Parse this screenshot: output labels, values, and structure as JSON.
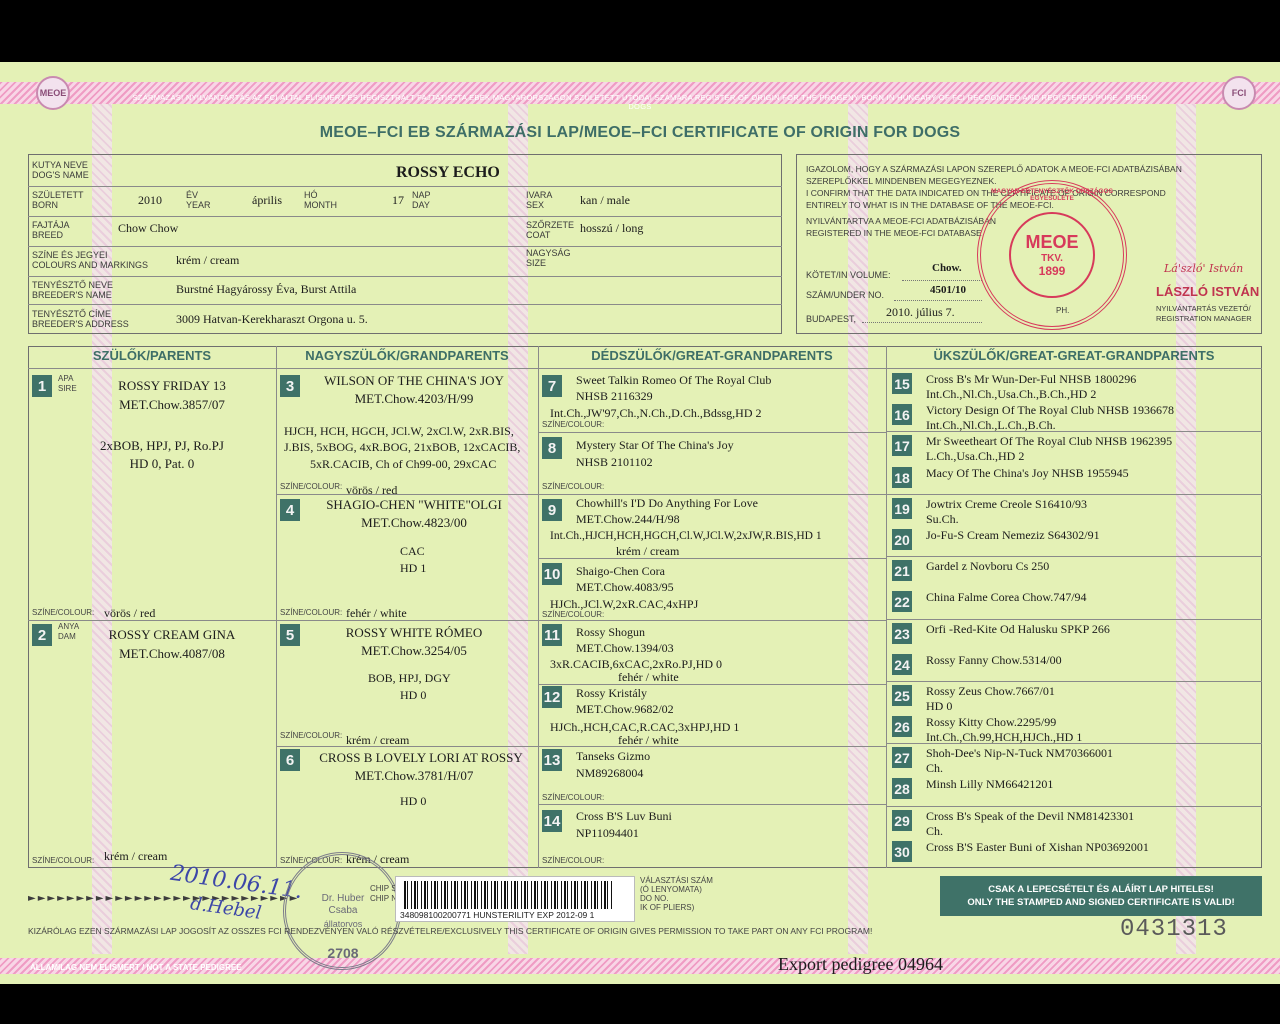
{
  "header": {
    "band_text": "SZÁRMAZÁSI NYILVÁNTARTÁS AZ FCI ÁLTAL ELISMERT ÉS REGISZTRÁLT FAJTATISZTA EBEK MAGYARORSZÁGON SZÜLETETT UTÓDAI SZÁMÁRA REGISTER OF ORIGIN FOR THE PROGENY BORN IN HUNGARY OF FCI RECOGNIZED AND REGISTERED PURE - BRED DOGS",
    "title": "MEOE–FCI EB SZÁRMAZÁSI LAP/MEOE–FCI CERTIFICATE OF ORIGIN FOR DOGS",
    "seal_left": "MEOE",
    "seal_right": "FCI"
  },
  "dog": {
    "name_label_hu": "KUTYA NEVE",
    "name_label_en": "DOG'S NAME",
    "name": "ROSSY ECHO",
    "born_label_hu": "SZÜLETETT",
    "born_label_en": "BORN",
    "year": "2010",
    "year_label_hu": "ÉV",
    "year_label_en": "YEAR",
    "month": "április",
    "month_label_hu": "HÓ",
    "month_label_en": "MONTH",
    "day": "17",
    "day_label_hu": "NAP",
    "day_label_en": "DAY",
    "sex_label_hu": "IVARA",
    "sex_label_en": "SEX",
    "sex": "kan / male",
    "breed_label_hu": "FAJTÁJA",
    "breed_label_en": "BREED",
    "breed": "Chow Chow",
    "coat_label_hu": "SZŐRZETE",
    "coat_label_en": "COAT",
    "coat": "hosszú / long",
    "colour_label_hu": "SZÍNE ÉS JEGYEI",
    "colour_label_en": "COLOURS AND MARKINGS",
    "colour": "krém / cream",
    "size_label_hu": "NAGYSÁG",
    "size_label_en": "SIZE",
    "breeder_label_hu": "TENYÉSZTŐ NEVE",
    "breeder_label_en": "BREEDER'S NAME",
    "breeder": "Burstné Hagyárossy Éva, Burst Attila",
    "address_label_hu": "TENYÉSZTŐ CÍME",
    "address_label_en": "BREEDER'S ADDRESS",
    "address": "3009 Hatvan-Kerekharaszt Orgona u. 5."
  },
  "registration": {
    "statement": [
      "IGAZOLOM, HOGY A SZÁRMAZÁSI LAPON SZEREPLŐ ADATOK A MEOE-FCI ADATBÁZISÁBAN",
      "SZEREPLŐKKEL MINDENBEN MEGEGYEZNEK.",
      "I CONFIRM THAT THE DATA INDICATED ON THE CERTIFICATE OF ORIGIN CORRESPOND",
      "ENTIRELY TO WHAT IS IN THE DATABASE OF THE MEOE-FCI.",
      "NYILVÁNTARTVA A MEOE-FCI ADATBÁZISÁBAN",
      "REGISTERED IN THE MEOE-FCI DATABASE"
    ],
    "volume_label": "KÖTET/IN VOLUME:",
    "volume": "Chow.",
    "number_label": "SZÁM/UNDER No.",
    "number": "4501/10",
    "city": "BUDAPEST,",
    "date": "2010. július 7.",
    "ph": "PH.",
    "signature": "Lá'szló' István",
    "signer_name": "LÁSZLÓ ISTVÁN",
    "signer_title_hu": "NYILVÁNTARTÁS VEZETŐ/",
    "signer_title_en": "REGISTRATION MANAGER"
  },
  "stamp_red": {
    "center": "MEOE",
    "tkv": "TKV.",
    "year": "1899",
    "ring": "MAGYAR EBTENYÉSZTŐK ORSZÁGOS EGYESÜLETE"
  },
  "columns": {
    "parents": "SZÜLŐK/PARENTS",
    "grandparents": "NAGYSZÜLŐK/GRANDPARENTS",
    "great": "DÉDSZÜLŐK/GREAT-GRANDPARENTS",
    "greatgreat": "ÜKSZÜLŐK/GREAT-GREAT-GRANDPARENTS"
  },
  "labels": {
    "colour": "SZÍNE/COLOUR:",
    "sire_hu": "APA",
    "sire_en": "SIRE",
    "dam_hu": "ANYA",
    "dam_en": "DAM"
  },
  "parents": [
    {
      "num": "1",
      "name": "ROSSY FRIDAY 13",
      "reg": "MET.Chow.3857/07",
      "titles": "2xBOB, HPJ, PJ, Ro.PJ",
      "hd": "HD 0, Pat. 0",
      "colour": "vörös / red"
    },
    {
      "num": "2",
      "name": "ROSSY CREAM GINA",
      "reg": "MET.Chow.4087/08",
      "colour": "krém / cream"
    }
  ],
  "grandparents": [
    {
      "num": "3",
      "name": "WILSON OF THE CHINA'S JOY",
      "reg": "MET.Chow.4203/H/99",
      "titles": [
        "HJCH, HCH, HGCH, JCl.W, 2xCl.W, 2xR.BIS,",
        "J.BIS, 5xBOG, 4xR.BOG, 21xBOB, 12xCACIB,",
        "5xR.CACIB, Ch of Ch99-00, 29xCAC"
      ],
      "colour": "vörös / red"
    },
    {
      "num": "4",
      "name": "SHAGIO-CHEN \"WHITE\"OLGI",
      "reg": "MET.Chow.4823/00",
      "titles": [
        "CAC"
      ],
      "hd": "HD 1",
      "colour": "fehér / white"
    },
    {
      "num": "5",
      "name": "ROSSY WHITE RÓMEO",
      "reg": "MET.Chow.3254/05",
      "titles": [
        "BOB, HPJ, DGY"
      ],
      "hd": "HD 0",
      "colour": "krém / cream"
    },
    {
      "num": "6",
      "name": "CROSS B LOVELY LORI AT ROSSY",
      "reg": "MET.Chow.3781/H/07",
      "hd": "HD 0",
      "colour": "krém / cream"
    }
  ],
  "great": [
    {
      "num": "7",
      "name": "Sweet Talkin Romeo Of The Royal Club",
      "reg": "NHSB 2116329",
      "titles": "Int.Ch.,JW'97,Ch.,N.Ch.,D.Ch.,Bdssg,HD 2"
    },
    {
      "num": "8",
      "name": "Mystery Star Of The China's Joy",
      "reg": "NHSB 2101102"
    },
    {
      "num": "9",
      "name": "Chowhill's I'D Do Anything For Love",
      "reg": "MET.Chow.244/H/98",
      "titles": "Int.Ch.,HJCH,HCH,HGCH,Cl.W,JCl.W,2xJW,R.BIS,HD 1",
      "colour": "krém / cream"
    },
    {
      "num": "10",
      "name": "Shaigo-Chen Cora",
      "reg": "MET.Chow.4083/95",
      "titles": "HJCh.,JCl.W,2xR.CAC,4xHPJ"
    },
    {
      "num": "11",
      "name": "Rossy Shogun",
      "reg": "MET.Chow.1394/03",
      "titles": "3xR.CACIB,6xCAC,2xRo.PJ,HD 0",
      "colour": "fehér / white"
    },
    {
      "num": "12",
      "name": "Rossy Kristály",
      "reg": "MET.Chow.9682/02",
      "titles": "HJCh.,HCH,CAC,R.CAC,3xHPJ,HD 1",
      "colour": "fehér / white"
    },
    {
      "num": "13",
      "name": "Tanseks Gizmo",
      "reg": "NM89268004"
    },
    {
      "num": "14",
      "name": "Cross B'S Luv Buni",
      "reg": "NP11094401"
    }
  ],
  "greatgreat": [
    {
      "num": "15",
      "line1": "Cross B's Mr Wun-Der-Ful NHSB 1800296",
      "line2": "Int.Ch.,Nl.Ch.,Usa.Ch.,B.Ch.,HD 2"
    },
    {
      "num": "16",
      "line1": "Victory Design Of The Royal Club NHSB 1936678",
      "line2": "Int.Ch.,Nl.Ch.,L.Ch.,B.Ch."
    },
    {
      "num": "17",
      "line1": "Mr Sweetheart Of The Royal Club NHSB 1962395",
      "line2": "L.Ch.,Usa.Ch.,HD 2"
    },
    {
      "num": "18",
      "line1": "Macy Of The China's Joy NHSB 1955945"
    },
    {
      "num": "19",
      "line1": "Jowtrix Creme Creole S16410/93",
      "line2": "Su.Ch."
    },
    {
      "num": "20",
      "line1": "Jo-Fu-S Cream Nemeziz S64302/91"
    },
    {
      "num": "21",
      "line1": "Gardel z Novboru Cs 250"
    },
    {
      "num": "22",
      "line1": "China Falme Corea Chow.747/94"
    },
    {
      "num": "23",
      "line1": "Orfi -Red-Kite Od  Halusku SPKP 266"
    },
    {
      "num": "24",
      "line1": "Rossy Fanny Chow.5314/00"
    },
    {
      "num": "25",
      "line1": "Rossy Zeus Chow.7667/01",
      "line2": "HD 0"
    },
    {
      "num": "26",
      "line1": "Rossy Kitty Chow.2295/99",
      "line2": "Int.Ch.,Ch.99,HCH,HJCh.,HD 1"
    },
    {
      "num": "27",
      "line1": "Shoh-Dee's Nip-N-Tuck NM70366001",
      "line2": "Ch."
    },
    {
      "num": "28",
      "line1": "Minsh Lilly NM66421201"
    },
    {
      "num": "29",
      "line1": "Cross B's Speak of the Devil NM81423301",
      "line2": "Ch."
    },
    {
      "num": "30",
      "line1": "Cross B'S Easter Buni of Xishan NP03692001"
    }
  ],
  "footer": {
    "chip_label_hu": "CHIP SZÁM",
    "chip_label_en": "CHIP No.",
    "tattoo_label": "VÁLASZTÁSI SZÁM",
    "tattoo_label2": "(Ó LENYOMATA)",
    "tattoo_label3": "DO No.",
    "tattoo_label4": "IK OF PLIERS)",
    "barcode_text": "348098100200771  HUNSTERILITY EXP 2012-09  1",
    "arrows": "►►►►►►►►►►►►►►►►►►►►►►►►►►►►",
    "notice_hu": "CSAK A LEPECSÉTELT ÉS ALÁÍRT LAP HITELES!",
    "notice_en": "ONLY THE STAMPED AND SIGNED CERTIFICATE IS VALID!",
    "permission": "KIZÁRÓLAG EZEN SZÁRMAZÁSI LAP JOGOSÍT AZ OSSZES FCI RENDEZVÉNYEN VALÓ RÉSZVÉTELRE/EXCLUSIVELY THIS CERTIFICATE OF ORIGIN GIVES PERMISSION TO TAKE PART ON ANY FCI PROGRAM!",
    "state": "ÁLLAMILAG NEM ELISMERT / NOT A STATE PEDIGREE",
    "serial": "0431313",
    "export": "Export pedigree 04964",
    "hand_date": "2010.06.11.",
    "hand_sig": "d.Hebel",
    "vet_name": "Dr. Huber Csaba",
    "vet_title": "állatorvos",
    "vet_code": "2708"
  }
}
